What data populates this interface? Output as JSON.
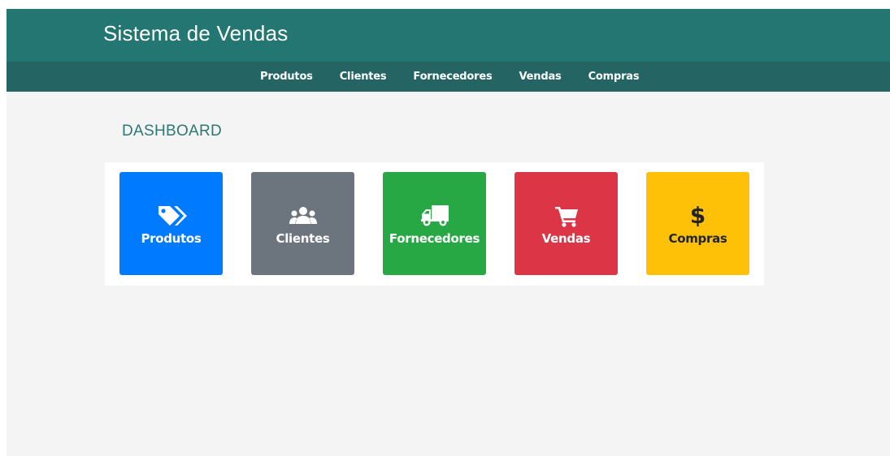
{
  "header": {
    "title": "Sistema de Vendas"
  },
  "nav": {
    "items": [
      {
        "label": "Produtos"
      },
      {
        "label": "Clientes"
      },
      {
        "label": "Fornecedores"
      },
      {
        "label": "Vendas"
      },
      {
        "label": "Compras"
      }
    ]
  },
  "main": {
    "title": "DASHBOARD"
  },
  "cards": [
    {
      "label": "Produtos",
      "icon": "tags-icon",
      "color": "#007bff"
    },
    {
      "label": "Clientes",
      "icon": "users-icon",
      "color": "#6c757d"
    },
    {
      "label": "Fornecedores",
      "icon": "truck-icon",
      "color": "#28a745"
    },
    {
      "label": "Vendas",
      "icon": "shopping-cart-icon",
      "color": "#dc3545"
    },
    {
      "label": "Compras",
      "icon": "dollar-icon",
      "icon_glyph": "$",
      "color": "#ffc107"
    }
  ],
  "colors": {
    "header": "#247672",
    "nav": "#246564",
    "background": "#f4f4f4",
    "title": "#2c7873"
  }
}
